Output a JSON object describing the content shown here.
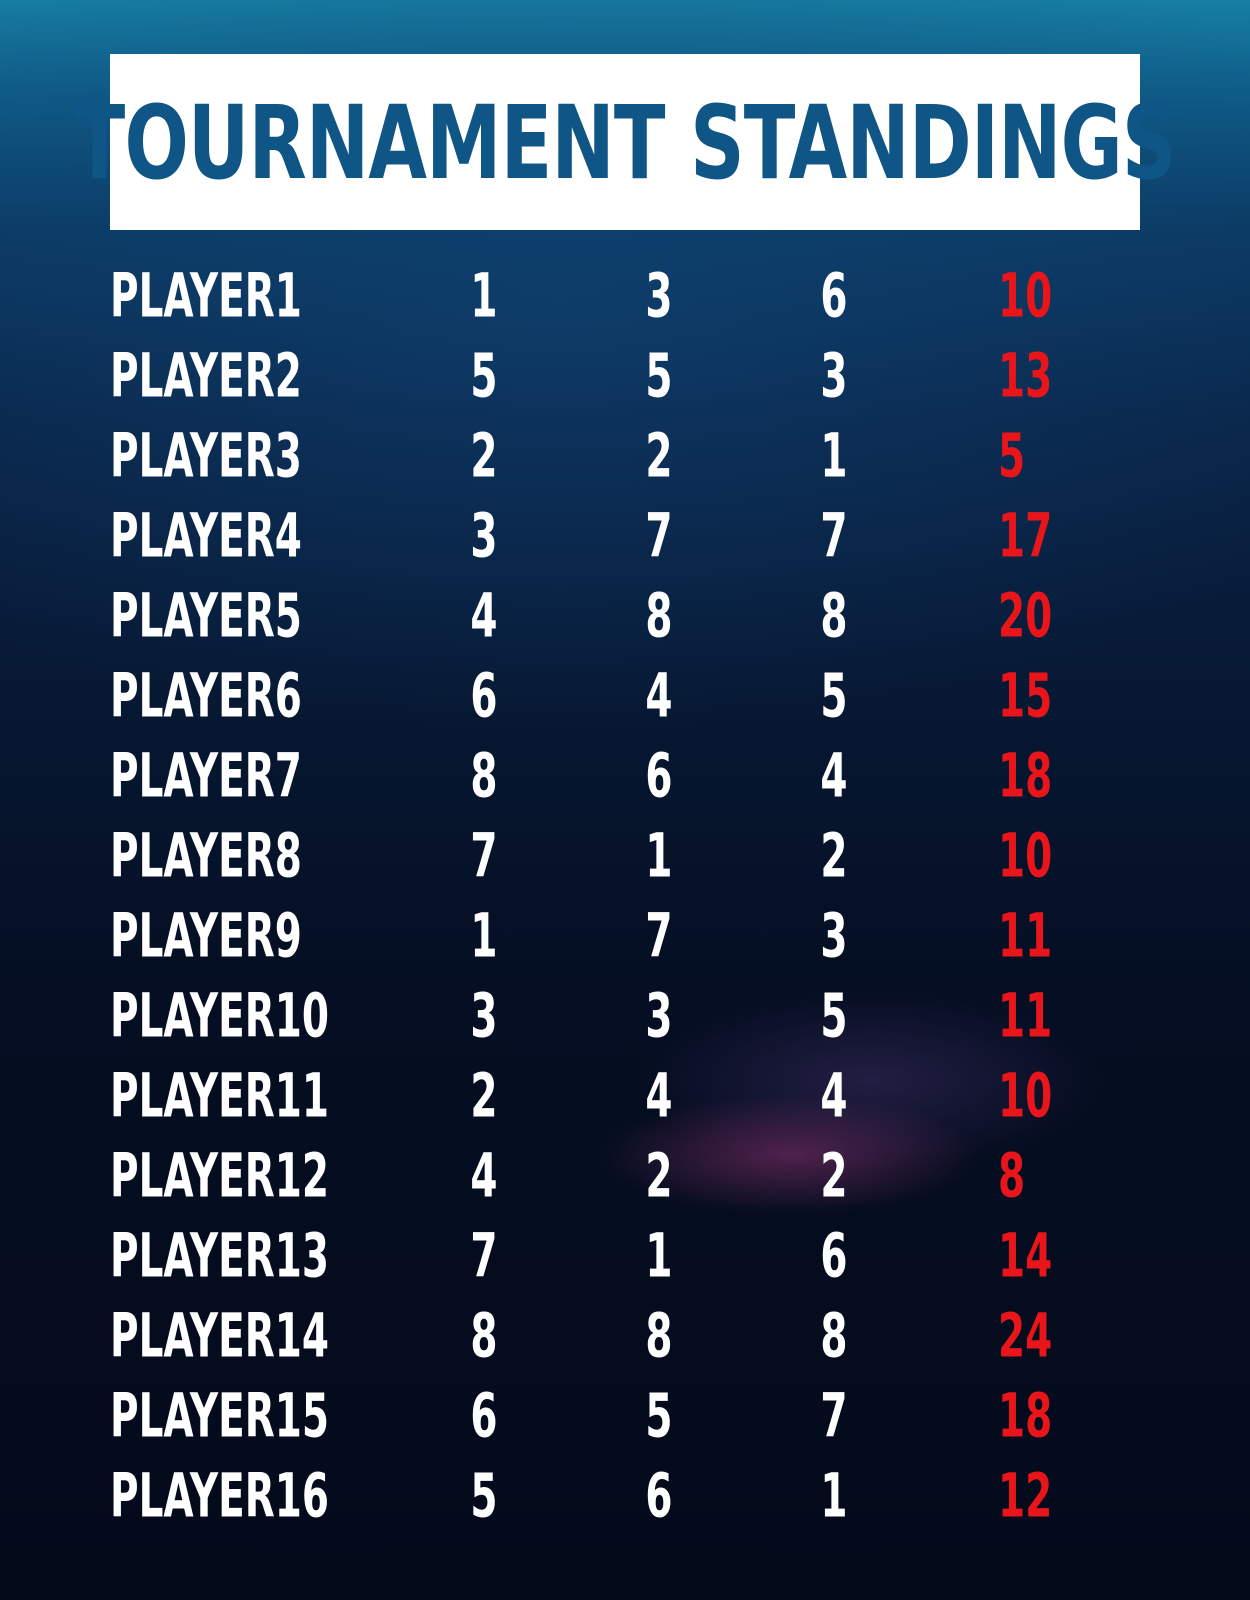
{
  "title": "TOURNAMENT STANDINGS",
  "colors": {
    "title_bg": "#ffffff",
    "title_text": "#0f5585",
    "text": "#ffffff",
    "total": "#e8161b",
    "background_top": "#177fa3",
    "background_bottom": "#040a1a"
  },
  "rows": [
    {
      "name": "PLAYER1",
      "r1": "1",
      "r2": "3",
      "r3": "6",
      "total": "10"
    },
    {
      "name": "PLAYER2",
      "r1": "5",
      "r2": "5",
      "r3": "3",
      "total": "13"
    },
    {
      "name": "PLAYER3",
      "r1": "2",
      "r2": "2",
      "r3": "1",
      "total": "5"
    },
    {
      "name": "PLAYER4",
      "r1": "3",
      "r2": "7",
      "r3": "7",
      "total": "17"
    },
    {
      "name": "PLAYER5",
      "r1": "4",
      "r2": "8",
      "r3": "8",
      "total": "20"
    },
    {
      "name": "PLAYER6",
      "r1": "6",
      "r2": "4",
      "r3": "5",
      "total": "15"
    },
    {
      "name": "PLAYER7",
      "r1": "8",
      "r2": "6",
      "r3": "4",
      "total": "18"
    },
    {
      "name": "PLAYER8",
      "r1": "7",
      "r2": "1",
      "r3": "2",
      "total": "10"
    },
    {
      "name": "PLAYER9",
      "r1": "1",
      "r2": "7",
      "r3": "3",
      "total": "11"
    },
    {
      "name": "PLAYER10",
      "r1": "3",
      "r2": "3",
      "r3": "5",
      "total": "11"
    },
    {
      "name": "PLAYER11",
      "r1": "2",
      "r2": "4",
      "r3": "4",
      "total": "10"
    },
    {
      "name": "PLAYER12",
      "r1": "4",
      "r2": "2",
      "r3": "2",
      "total": "8"
    },
    {
      "name": "PLAYER13",
      "r1": "7",
      "r2": "1",
      "r3": "6",
      "total": "14"
    },
    {
      "name": "PLAYER14",
      "r1": "8",
      "r2": "8",
      "r3": "8",
      "total": "24"
    },
    {
      "name": "PLAYER15",
      "r1": "6",
      "r2": "5",
      "r3": "7",
      "total": "18"
    },
    {
      "name": "PLAYER16",
      "r1": "5",
      "r2": "6",
      "r3": "1",
      "total": "12"
    }
  ]
}
